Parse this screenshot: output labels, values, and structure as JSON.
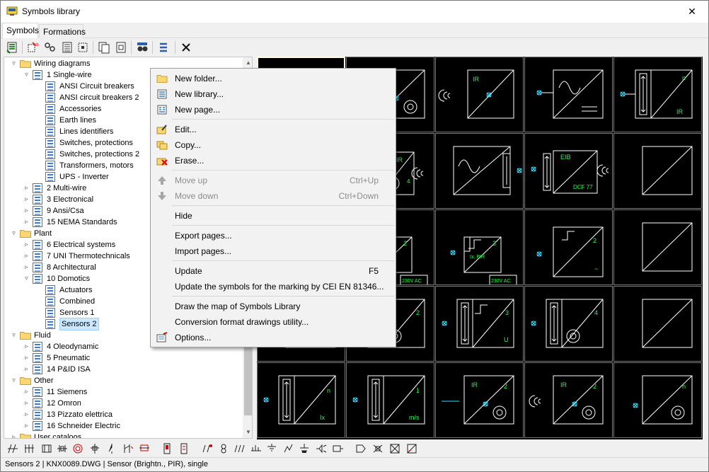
{
  "window": {
    "title": "Symbols library",
    "close_glyph": "✕"
  },
  "tabs": [
    {
      "label": "Symbols",
      "active": true
    },
    {
      "label": "Formations",
      "active": false
    }
  ],
  "toolbar": {
    "icons": [
      "new-library-icon",
      "new-page-icon",
      "links-icon",
      "list-icon",
      "select-frame-icon",
      "copy-page-icon",
      "paste-page-icon",
      "binoculars-icon",
      "list-view-icon",
      "close-icon"
    ]
  },
  "tree": {
    "items": [
      {
        "label": "Wiring diagrams",
        "level": 0,
        "type": "folder",
        "expanded": true
      },
      {
        "label": "1 Single-wire",
        "level": 1,
        "type": "library",
        "expanded": true
      },
      {
        "label": "ANSI Circuit breakers",
        "level": 2,
        "type": "page"
      },
      {
        "label": "ANSI circuit breakers 2",
        "level": 2,
        "type": "page"
      },
      {
        "label": "Accessories",
        "level": 2,
        "type": "page"
      },
      {
        "label": "Earth lines",
        "level": 2,
        "type": "page"
      },
      {
        "label": "Lines identifiers",
        "level": 2,
        "type": "page"
      },
      {
        "label": "Switches, protections",
        "level": 2,
        "type": "page"
      },
      {
        "label": "Switches, protections 2",
        "level": 2,
        "type": "page"
      },
      {
        "label": "Transformers, motors",
        "level": 2,
        "type": "page"
      },
      {
        "label": "UPS - Inverter",
        "level": 2,
        "type": "page"
      },
      {
        "label": "2 Multi-wire",
        "level": 1,
        "type": "library",
        "expanded": false
      },
      {
        "label": "3 Electronical",
        "level": 1,
        "type": "library",
        "expanded": false
      },
      {
        "label": "9 Ansi/Csa",
        "level": 1,
        "type": "library",
        "expanded": false
      },
      {
        "label": "15 NEMA Standards",
        "level": 1,
        "type": "library",
        "expanded": false
      },
      {
        "label": "Plant",
        "level": 0,
        "type": "folder",
        "expanded": true
      },
      {
        "label": "6 Electrical systems",
        "level": 1,
        "type": "library",
        "expanded": false
      },
      {
        "label": "7 UNI Thermotechnicals",
        "level": 1,
        "type": "library",
        "expanded": false
      },
      {
        "label": "8 Architectural",
        "level": 1,
        "type": "library",
        "expanded": false
      },
      {
        "label": "10 Domotics",
        "level": 1,
        "type": "library",
        "expanded": true
      },
      {
        "label": "Actuators",
        "level": 2,
        "type": "page"
      },
      {
        "label": "Combined",
        "level": 2,
        "type": "page"
      },
      {
        "label": "Sensors 1",
        "level": 2,
        "type": "page"
      },
      {
        "label": "Sensors 2",
        "level": 2,
        "type": "page",
        "selected": true
      },
      {
        "label": "Fluid",
        "level": 0,
        "type": "folder",
        "expanded": true
      },
      {
        "label": "4 Oleodynamic",
        "level": 1,
        "type": "library",
        "expanded": false
      },
      {
        "label": "5 Pneumatic",
        "level": 1,
        "type": "library",
        "expanded": false
      },
      {
        "label": "14 P&ID ISA",
        "level": 1,
        "type": "library",
        "expanded": false
      },
      {
        "label": "Other",
        "level": 0,
        "type": "folder",
        "expanded": true
      },
      {
        "label": "11 Siemens",
        "level": 1,
        "type": "library",
        "expanded": false
      },
      {
        "label": "12 Omron",
        "level": 1,
        "type": "library",
        "expanded": false
      },
      {
        "label": "13 Pizzato elettrica",
        "level": 1,
        "type": "library",
        "expanded": false
      },
      {
        "label": "16 Schneider Electric",
        "level": 1,
        "type": "library",
        "expanded": false
      },
      {
        "label": "User cataloos",
        "level": 0,
        "type": "folder",
        "expanded": false
      }
    ]
  },
  "context_menu": {
    "items": [
      {
        "label": "New folder...",
        "icon": "folder-icon",
        "shortcut": "",
        "disabled": false
      },
      {
        "label": "New library...",
        "icon": "library-icon",
        "shortcut": "",
        "disabled": false
      },
      {
        "label": "New page...",
        "icon": "page-icon",
        "shortcut": "",
        "disabled": false
      },
      {
        "sep": true
      },
      {
        "label": "Edit...",
        "icon": "edit-icon",
        "shortcut": "",
        "disabled": false
      },
      {
        "label": "Copy...",
        "icon": "copy-icon",
        "shortcut": "",
        "disabled": false
      },
      {
        "label": "Erase...",
        "icon": "erase-icon",
        "shortcut": "",
        "disabled": false
      },
      {
        "sep": true
      },
      {
        "label": "Move up",
        "icon": "arrow-up-icon",
        "shortcut": "Ctrl+Up",
        "disabled": true
      },
      {
        "label": "Move down",
        "icon": "arrow-down-icon",
        "shortcut": "Ctrl+Down",
        "disabled": true
      },
      {
        "sep": true
      },
      {
        "label": "Hide",
        "icon": "",
        "shortcut": "",
        "disabled": false
      },
      {
        "sep": true
      },
      {
        "label": "Export pages...",
        "icon": "",
        "shortcut": "",
        "disabled": false
      },
      {
        "label": "Import pages...",
        "icon": "",
        "shortcut": "",
        "disabled": false
      },
      {
        "sep": true
      },
      {
        "label": "Update",
        "icon": "",
        "shortcut": "F5",
        "disabled": false
      },
      {
        "label": "Update the symbols for the marking by CEI EN 81346...",
        "icon": "",
        "shortcut": "",
        "disabled": false
      },
      {
        "sep": true
      },
      {
        "label": "Draw the map of Symbols Library",
        "icon": "",
        "shortcut": "",
        "disabled": false
      },
      {
        "label": "Conversion format drawings utility...",
        "icon": "",
        "shortcut": "",
        "disabled": false
      },
      {
        "label": "Options...",
        "icon": "options-icon",
        "shortcut": "",
        "disabled": false
      }
    ]
  },
  "symbols": {
    "rows": [
      [
        {
          "kind": "blank",
          "selected": true
        },
        {
          "kind": "circle-sensor",
          "text": "",
          "sub": ""
        },
        {
          "kind": "ir-arcs",
          "text": "IR",
          "sub": ""
        },
        {
          "kind": "wave",
          "text": "",
          "sub": ""
        },
        {
          "kind": "updown-box",
          "text": "n",
          "sub": "IR"
        }
      ],
      [
        {
          "kind": "hidden",
          "text": "",
          "sub": ""
        },
        {
          "kind": "ir-circle-updown",
          "text": "IR",
          "sub": "4"
        },
        {
          "kind": "wave-bar",
          "text": "",
          "sub": ""
        },
        {
          "kind": "dcf",
          "text": "EIB",
          "sub": "DCF 77"
        },
        {
          "kind": "hidden",
          "text": "",
          "sub": ""
        }
      ],
      [
        {
          "kind": "hidden",
          "text": "",
          "sub": ""
        },
        {
          "kind": "step-pir",
          "text": "2",
          "sub": "Ix. PIR",
          "extra": "230V AC"
        },
        {
          "kind": "step-pir",
          "text": "3",
          "sub": "Ix. PIR",
          "extra": "230V AC"
        },
        {
          "kind": "step-big",
          "text": "2",
          "sub": "~"
        },
        {
          "kind": "hidden",
          "text": "",
          "sub": ""
        }
      ],
      [
        {
          "kind": "hidden",
          "text": "",
          "sub": ""
        },
        {
          "kind": "circle-updown",
          "text": "2",
          "sub": ""
        },
        {
          "kind": "step-updown",
          "text": "3",
          "sub": "U"
        },
        {
          "kind": "circle-updown",
          "text": "4",
          "sub": ""
        },
        {
          "kind": "hidden",
          "text": "",
          "sub": ""
        }
      ],
      [
        {
          "kind": "updown-plain",
          "text": "n",
          "sub": "Ix"
        },
        {
          "kind": "updown-plain",
          "text": "1",
          "sub": "m/s"
        },
        {
          "kind": "ir-circle",
          "text": "IR",
          "sub": "2"
        },
        {
          "kind": "ir-arcs-circle",
          "text": "IR",
          "sub": "2"
        },
        {
          "kind": "circle-plain",
          "text": "n",
          "sub": ""
        }
      ]
    ],
    "partial_texts": {
      "r2c0": "1",
      "r3c0": "1"
    }
  },
  "bottom_toolbar": {
    "icons": [
      "contact-icon",
      "terminal-icon",
      "relay-icon",
      "motor-icon",
      "lamp-icon",
      "coil-icon",
      "switch-icon",
      "breaker-icon",
      "fuse-icon",
      "meter-icon",
      "plug-icon",
      "transformer-icon",
      "antenna-icon",
      "diode-icon",
      "resistor-icon",
      "capacitor-icon",
      "earth-icon",
      "socket-icon",
      "sensor-icon",
      "speaker-icon",
      "pushbutton-icon",
      "valve-icon",
      "motor-small-icon",
      "box-x-icon",
      "box-diag-icon"
    ]
  },
  "status": {
    "text": "Sensors 2 | KNX0089.DWG | Sensor (Brightn., PIR), single"
  }
}
